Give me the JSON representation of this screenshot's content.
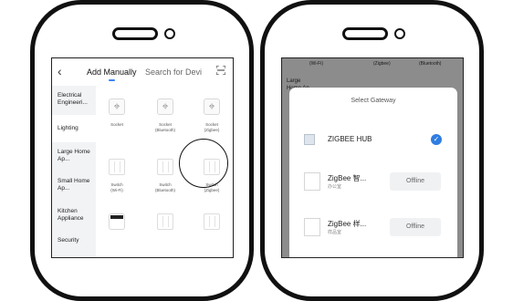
{
  "left_screen": {
    "back_label": "‹",
    "tabs": [
      "Add Manually",
      "Search for Devi"
    ],
    "scan_icon": "scan-icon",
    "categories": [
      "Electrical Engineeri...",
      "Lighting",
      "Large Home Ap...",
      "Small Home Ap...",
      "Kitchen Appliance",
      "Security"
    ],
    "tiles": [
      {
        "icon": "socket-icon",
        "label": "Socket",
        "sub": ""
      },
      {
        "icon": "socket-icon",
        "label": "Socket",
        "sub": "(Bluetooth)"
      },
      {
        "icon": "socket-icon",
        "label": "Socket",
        "sub": "(Zigbee)"
      },
      {
        "icon": "switch-icon",
        "label": "Switch",
        "sub": "(Wi-Fi)"
      },
      {
        "icon": "switch-icon",
        "label": "Switch",
        "sub": "(Bluetooth)"
      },
      {
        "icon": "switch-icon",
        "label": "Switch",
        "sub": "(Zigbee)"
      }
    ]
  },
  "right_screen": {
    "background_labels": [
      "(Wi-Fi)",
      "(Zigbee)",
      "(Bluetooth)",
      "Large",
      "Home Ap..."
    ],
    "modal": {
      "title": "Select Gateway",
      "gateways": [
        {
          "name": "ZIGBEE HUB",
          "sub": "",
          "status": "selected"
        },
        {
          "name": "ZigBee 智...",
          "sub": "办公室",
          "status": "Offline"
        },
        {
          "name": "ZigBee 样...",
          "sub": "样品室",
          "status": "Offline"
        }
      ]
    }
  },
  "colors": {
    "accent": "#2f7de1",
    "frame": "#111111"
  }
}
